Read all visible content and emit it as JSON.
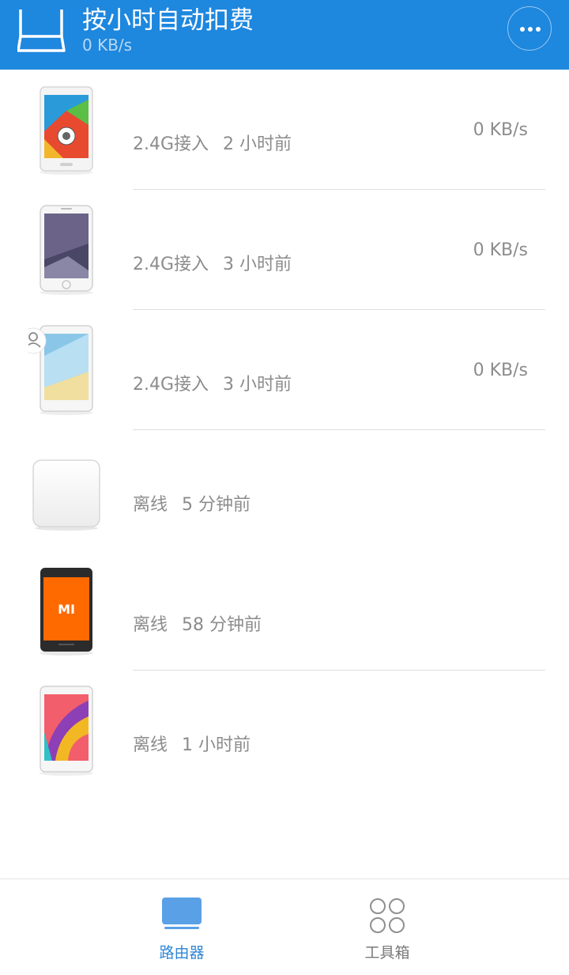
{
  "header": {
    "title": "按小时自动扣费",
    "subtitle": "0 KB/s",
    "logo_icon": "router-icon",
    "more_icon": "more-icon"
  },
  "devices": [
    {
      "icon": "phone-icon",
      "status": "2.4G接入",
      "time": "2 小时前",
      "speed": "0 KB/s"
    },
    {
      "icon": "phone-icon",
      "status": "2.4G接入",
      "time": "3 小时前",
      "speed": "0 KB/s"
    },
    {
      "icon": "phone-icon",
      "status": "2.4G接入",
      "time": "3 小时前",
      "speed": "0 KB/s",
      "badge": "user-icon"
    },
    {
      "icon": "router-box-icon",
      "status": "离线",
      "time": "5 分钟前",
      "speed": ""
    },
    {
      "icon": "phone-icon",
      "status": "离线",
      "time": "58 分钟前",
      "speed": "",
      "brand": "MI"
    },
    {
      "icon": "phone-icon",
      "status": "离线",
      "time": "1 小时前",
      "speed": ""
    }
  ],
  "tabbar": {
    "router_label": "路由器",
    "tools_label": "工具箱",
    "active": "router",
    "accent_color": "#2f86d5"
  },
  "colors": {
    "header_bg": "#1e87de",
    "text_secondary": "#8c8c8c"
  }
}
